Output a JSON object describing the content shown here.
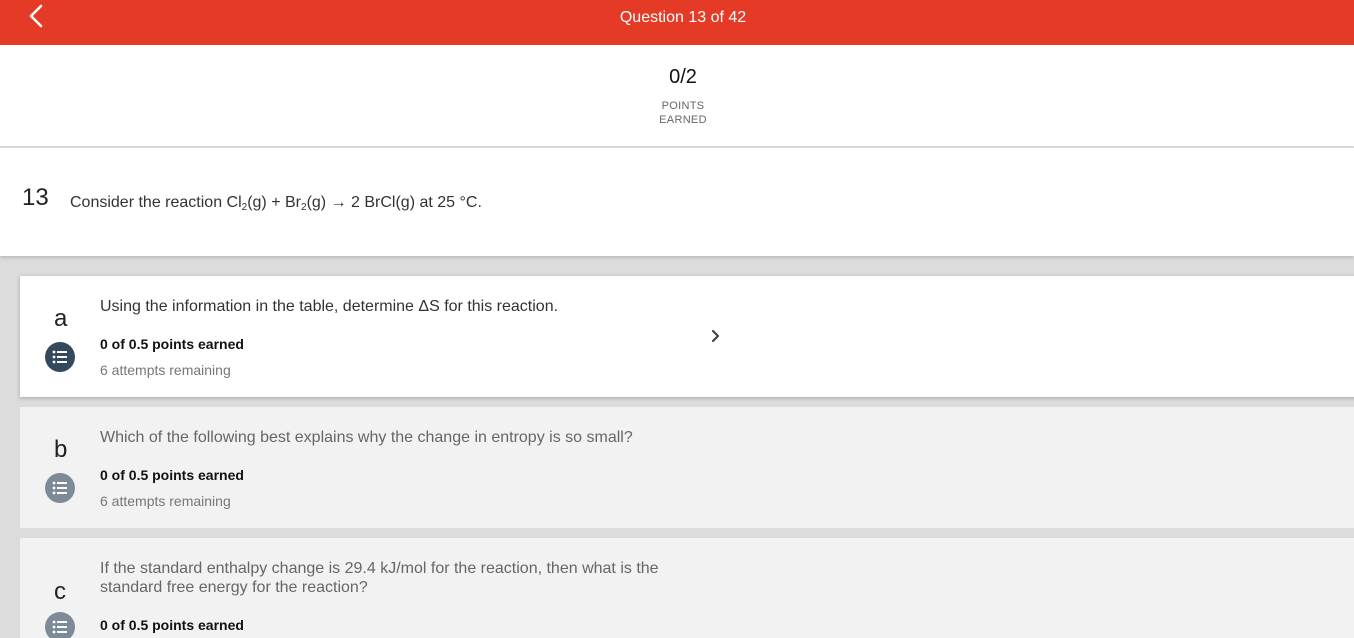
{
  "header": {
    "title": "Question 13 of 42",
    "back_icon": "chevron-left-icon",
    "background": "#e53a26"
  },
  "score": {
    "value": "0/2",
    "label_line1": "POINTS",
    "label_line2": "EARNED"
  },
  "question": {
    "number": "13",
    "text_prefix": "Consider the reaction Cl",
    "sub1": "2",
    "text_mid1": "(g) + Br",
    "sub2": "2",
    "text_suffix": "(g) → 2 BrCl(g) at 25 °C."
  },
  "parts": [
    {
      "letter": "a",
      "question": "Using the information in the table, determine ΔS for this reaction.",
      "points": "0 of 0.5 points earned",
      "attempts": "6 attempts remaining",
      "icon": "list-icon",
      "expand_icon": "chevron-right-icon"
    },
    {
      "letter": "b",
      "question": "Which of the following best explains why the change in entropy is so small?",
      "points": "0 of 0.5 points earned",
      "attempts": "6 attempts remaining",
      "icon": "list-icon"
    },
    {
      "letter": "c",
      "question": "If the standard enthalpy change is 29.4 kJ/mol for the reaction, then what is the standard free energy for the reaction?",
      "points": "0 of 0.5 points earned",
      "icon": "list-icon"
    }
  ]
}
